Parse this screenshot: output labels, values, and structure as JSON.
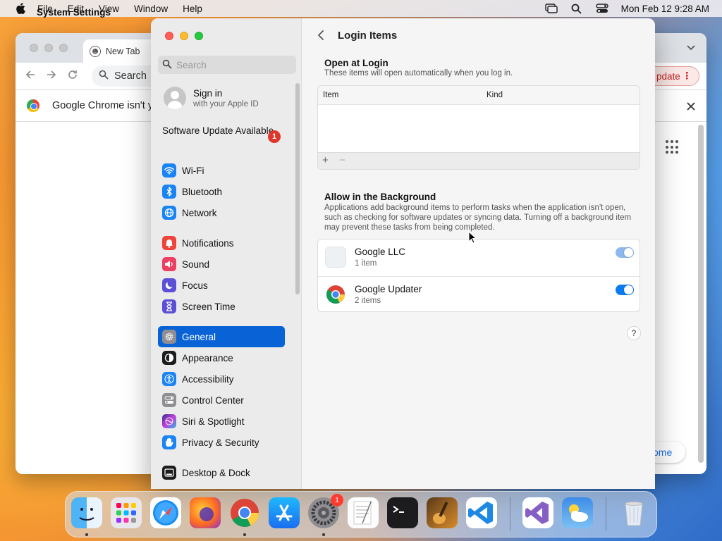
{
  "menubar": {
    "app_name": "System Settings",
    "menus": [
      "File",
      "Edit",
      "View",
      "Window",
      "Help"
    ],
    "datetime": "Mon Feb 12  9:28 AM"
  },
  "chrome": {
    "tab_title": "New Tab",
    "omnibox_text": "Search",
    "update_label": "pdate",
    "infobar_text": "Google Chrome isn't yo",
    "home_label": "ome"
  },
  "sidebar": {
    "search_placeholder": "Search",
    "signin_title": "Sign in",
    "signin_subtitle": "with your Apple ID",
    "software_update": "Software Update Available",
    "software_update_badge": "1",
    "items": [
      {
        "label": "Wi-Fi",
        "color": "#1a84f5",
        "icon": "wifi-icon"
      },
      {
        "label": "Bluetooth",
        "color": "#1a84f5",
        "icon": "bluetooth-icon"
      },
      {
        "label": "Network",
        "color": "#1a84f5",
        "icon": "globe-icon"
      },
      {
        "label": "Notifications",
        "color": "#f0433a",
        "icon": "bell-icon"
      },
      {
        "label": "Sound",
        "color": "#f0433a",
        "icon": "speaker-icon"
      },
      {
        "label": "Focus",
        "color": "#5b4fd8",
        "icon": "moon-icon"
      },
      {
        "label": "Screen Time",
        "color": "#5b4fd8",
        "icon": "hourglass-icon"
      },
      {
        "label": "General",
        "color": "#8e8e93",
        "icon": "gear-icon"
      },
      {
        "label": "Appearance",
        "color": "#1c1c1e",
        "icon": "appearance-icon"
      },
      {
        "label": "Accessibility",
        "color": "#1a84f5",
        "icon": "accessibility-icon"
      },
      {
        "label": "Control Center",
        "color": "#8e8e93",
        "icon": "toggles-icon"
      },
      {
        "label": "Siri & Spotlight",
        "color": "#b445d9",
        "icon": "siri-icon"
      },
      {
        "label": "Privacy & Security",
        "color": "#1a84f5",
        "icon": "hand-icon"
      },
      {
        "label": "Desktop & Dock",
        "color": "#1c1c1e",
        "icon": "dock-icon"
      }
    ],
    "selected": "General"
  },
  "content": {
    "page_title": "Login Items",
    "open_at_login": {
      "title": "Open at Login",
      "description": "These items will open automatically when you log in.",
      "columns": [
        "Item",
        "Kind"
      ],
      "add_label": "+",
      "remove_label": "−"
    },
    "background": {
      "title": "Allow in the Background",
      "description": "Applications add background items to perform tasks when the application isn't open, such as checking for software updates or syncing data. Turning off a background item may prevent these tasks from being completed.",
      "items": [
        {
          "name": "Google LLC",
          "count": "1 item",
          "enabled": true
        },
        {
          "name": "Google Updater",
          "count": "2 items",
          "enabled": true
        }
      ]
    },
    "help_label": "?"
  },
  "dock": {
    "apps": [
      "Finder",
      "Launchpad",
      "Safari",
      "Firefox",
      "Google Chrome",
      "App Store",
      "System Settings",
      "TextEdit",
      "Terminal",
      "GarageBand",
      "Visual Studio Code",
      "Visual Studio",
      "Weather",
      "Trash"
    ],
    "system_settings_badge": "1"
  }
}
